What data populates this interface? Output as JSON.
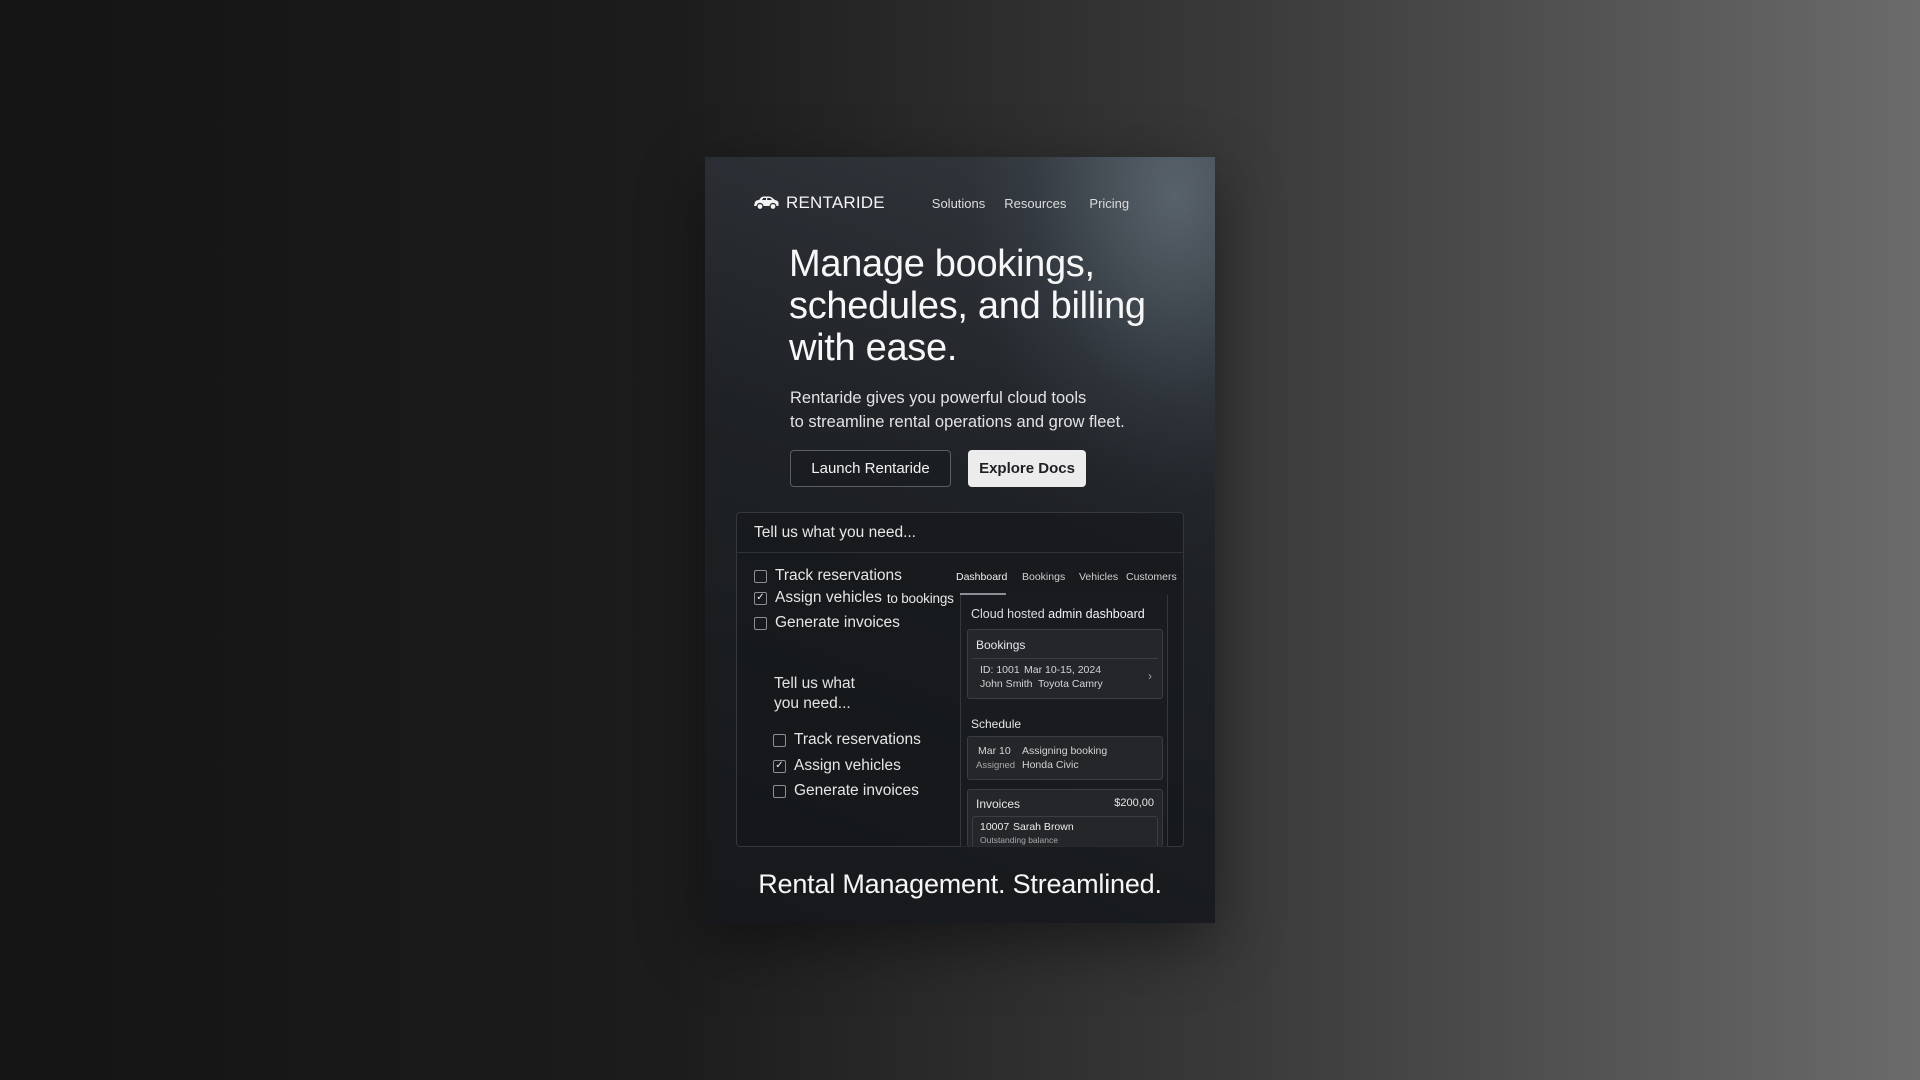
{
  "brand": {
    "name": "RENTARIDE",
    "icon": "car-icon"
  },
  "nav": {
    "links": [
      "Solutions",
      "Resources",
      "Pricing"
    ]
  },
  "hero": {
    "title_lines": [
      "Manage bookings,",
      "schedules, and billing",
      "with ease."
    ],
    "subtitle_lines": [
      "Rentaride gives you powerful cloud tools",
      "to streamline rental operations and grow fleet."
    ],
    "primary_button": "Launch Rentaride",
    "secondary_button": "Explore Docs"
  },
  "panel": {
    "heading": "Tell us what you need...",
    "checklist": [
      {
        "label": "Track reservations",
        "checked": false
      },
      {
        "label": "Assign vehicles",
        "tail": "to bookings",
        "checked": true
      },
      {
        "label": "Generate invoices",
        "checked": false
      }
    ],
    "sub_heading_lines": [
      "Tell us what",
      "you need..."
    ],
    "sub_checklist": [
      {
        "label": "Track reservations",
        "checked": false
      },
      {
        "label": "Assign vehicles",
        "checked": true
      },
      {
        "label": "Generate invoices",
        "checked": false
      }
    ],
    "check_mark": "✓"
  },
  "dashboard": {
    "tabs": [
      "Dashboard",
      "Bookings",
      "Vehicles",
      "Customers"
    ],
    "active_tab": "Dashboard",
    "caption_prefix": "Cloud hosted",
    "caption_strong": "admin dashboard",
    "bookings": {
      "title": "Bookings",
      "id": "ID: 1001",
      "dates": "Mar 10-15, 2024",
      "customer": "John Smith",
      "vehicle": "Toyota Camry"
    },
    "schedule": {
      "title": "Schedule",
      "date": "Mar 10",
      "event": "Assigning booking",
      "status": "Assigned",
      "vehicle": "Honda Civic"
    },
    "invoices": {
      "title": "Invoices",
      "amount": "$200,00",
      "number": "10007",
      "customer": "Sarah Brown",
      "note": "Outstanding balance"
    }
  },
  "tagline": "Rental Management. Streamlined."
}
